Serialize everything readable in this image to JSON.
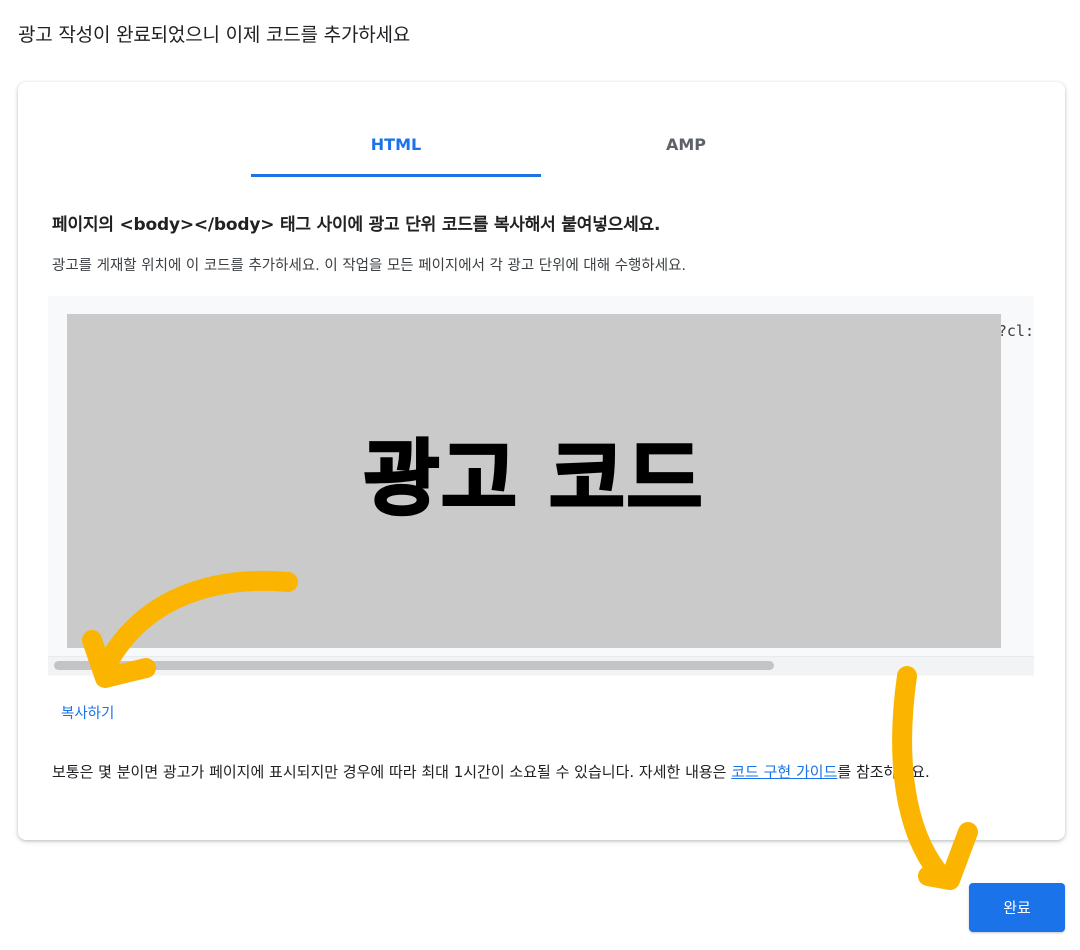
{
  "page": {
    "title": "광고 작성이 완료되었으니 이제 코드를 추가하세요"
  },
  "tabs": [
    {
      "label": "HTML",
      "active": true
    },
    {
      "label": "AMP",
      "active": false
    }
  ],
  "instructions": {
    "heading": "페이지의 <body></body> 태그 사이에 광고 단위 코드를 복사해서 붙여넣으세요.",
    "subtext": "광고를 게재할 위치에 이 코드를 추가하세요. 이 작업을 모든 페이지에서 각 광고 단위에 대해 수행하세요."
  },
  "code": {
    "visible_snippet": "?cl:",
    "overlay_label": "광고 코드"
  },
  "copy_link": "복사하기",
  "footer": {
    "text_before": "보통은 몇 분이면 광고가 페이지에 표시되지만 경우에 따라 최대 1시간이 소요될 수 있습니다. 자세한 내용은 ",
    "link_text": "코드 구현 가이드",
    "text_after": "를 참조하세요."
  },
  "done_button": "완료",
  "colors": {
    "accent": "#1a73e8",
    "annotation_arrow": "#fbb400",
    "overlay_gray": "#cacaca"
  }
}
